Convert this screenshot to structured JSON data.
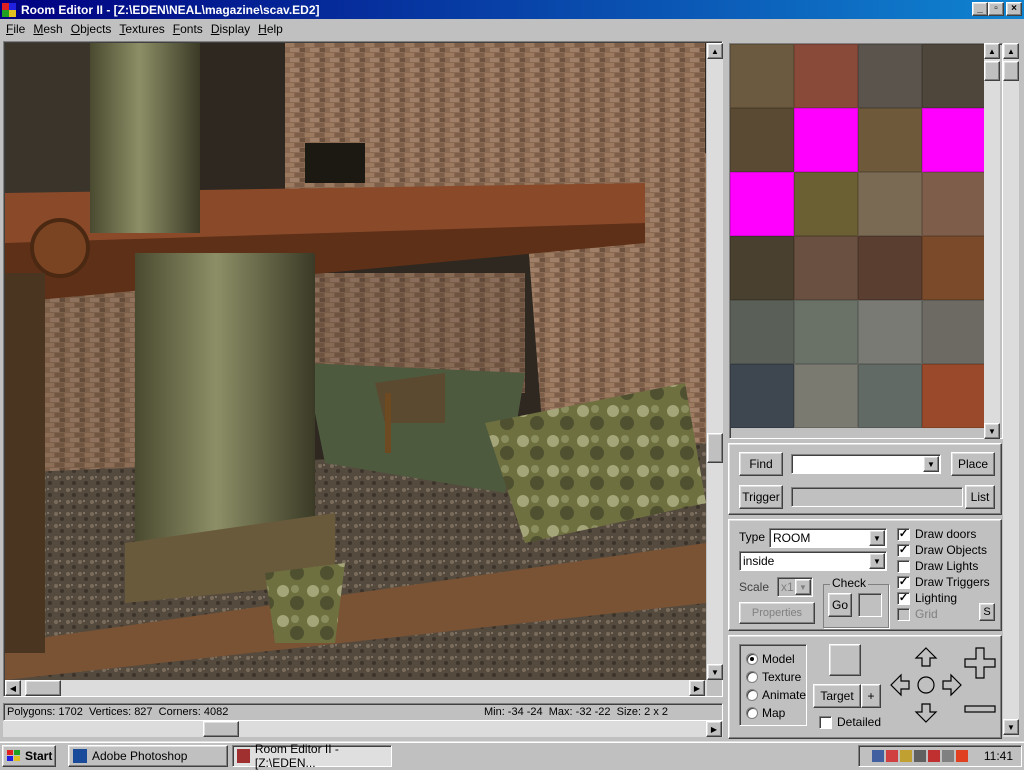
{
  "window": {
    "title": "Room Editor II - [Z:\\EDEN\\NEAL\\magazine\\scav.ED2]"
  },
  "menu": {
    "items": [
      "File",
      "Mesh",
      "Objects",
      "Textures",
      "Fonts",
      "Display",
      "Help"
    ]
  },
  "status": {
    "stats": "Polygons: 1702  Vertices: 827  Corners: 4082",
    "bounds": "Min: -34 -24  Max: -32 -22  Size: 2 x 2"
  },
  "search": {
    "find_label": "Find",
    "place_label": "Place",
    "trigger_label": "Trigger",
    "list_label": "List",
    "find_value": "",
    "trigger_value": ""
  },
  "props": {
    "type_label": "Type",
    "type_value": "ROOM",
    "location_value": "inside",
    "scale_label": "Scale",
    "scale_value": "x1",
    "check_label": "Check",
    "go_label": "Go",
    "properties_label": "Properties"
  },
  "draw_options": [
    {
      "label": "Draw doors",
      "checked": true,
      "enabled": true
    },
    {
      "label": "Draw Objects",
      "checked": true,
      "enabled": true
    },
    {
      "label": "Draw Lights",
      "checked": false,
      "enabled": true
    },
    {
      "label": "Draw Triggers",
      "checked": true,
      "enabled": true
    },
    {
      "label": "Lighting",
      "checked": true,
      "enabled": true
    },
    {
      "label": "Grid",
      "checked": false,
      "enabled": false
    }
  ],
  "lighting_s_label": "S",
  "modes": [
    {
      "label": "Model",
      "selected": true
    },
    {
      "label": "Texture",
      "selected": false
    },
    {
      "label": "Animate",
      "selected": false
    },
    {
      "label": "Map",
      "selected": false
    }
  ],
  "nav": {
    "target_label": "Target",
    "plus_label": "+",
    "detailed_label": "Detailed"
  },
  "taskbar": {
    "start_label": "Start",
    "tasks": [
      "Adobe Photoshop",
      "Room Editor II - [Z:\\EDEN..."
    ],
    "clock": "11:41"
  },
  "colors": {
    "title_start": "#000080",
    "title_end": "#1084d0",
    "face": "#c0c0c0",
    "magenta_texture": "#ff00ff"
  }
}
